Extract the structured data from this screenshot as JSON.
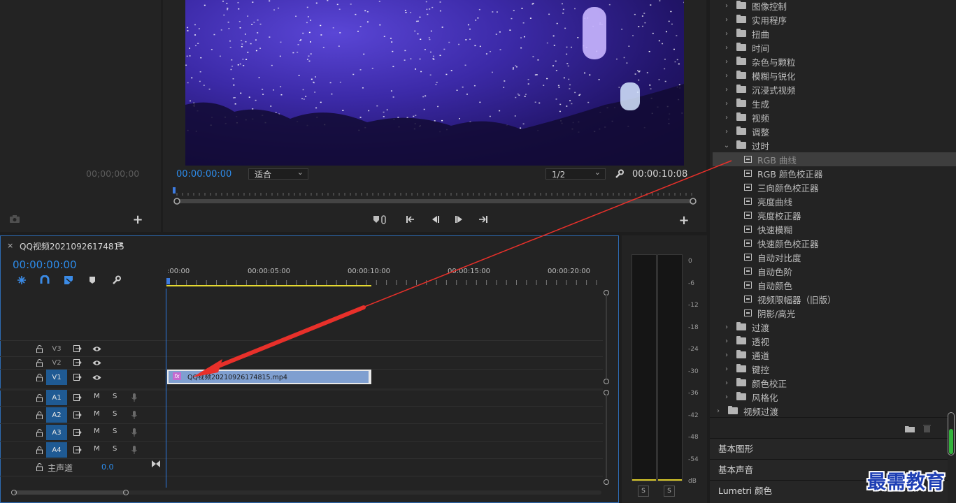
{
  "source": {
    "timecode": "00;00;00;00"
  },
  "program": {
    "timecode": "00:00:00:00",
    "fit": "适合",
    "resolution": "1/2",
    "duration": "00:00:10:08"
  },
  "timeline": {
    "sequence_name": "QQ视频20210926174815",
    "timecode": "00:00:00:00",
    "ruler": [
      ":00:00",
      "00:00:05:00",
      "00:00:10:00",
      "00:00:15:00",
      "00:00:20:00"
    ],
    "video_tracks": [
      "V3",
      "V2",
      "V1"
    ],
    "audio_tracks": [
      "A1",
      "A2",
      "A3",
      "A4"
    ],
    "target_video": "V1",
    "mute_label": "M",
    "solo_label": "S",
    "master_label": "主声道",
    "master_value": "0.0",
    "clip_label": "QQ视频20210926174815.mp4",
    "clip_fx": "fx"
  },
  "meter": {
    "scale": [
      "0",
      "-6",
      "-12",
      "-18",
      "-24",
      "-30",
      "-36",
      "-42",
      "-48",
      "-54",
      "dB"
    ],
    "solo_left": "S",
    "solo_right": "S"
  },
  "effects": {
    "folders_top": [
      "图像控制",
      "实用程序",
      "扭曲",
      "时间",
      "杂色与颗粒",
      "模糊与锐化",
      "沉浸式视频",
      "生成",
      "视频",
      "调整"
    ],
    "open_folder": "过时",
    "open_items": [
      "RGB 曲线",
      "RGB 颜色校正器",
      "三向颜色校正器",
      "亮度曲线",
      "亮度校正器",
      "快速模糊",
      "快速颜色校正器",
      "自动对比度",
      "自动色阶",
      "自动颜色",
      "视频限幅器（旧版）",
      "阴影/高光"
    ],
    "selected_item": "RGB 曲线",
    "folders_bottom": [
      "过渡",
      "透视",
      "通道",
      "键控",
      "颜色校正",
      "风格化"
    ],
    "root_folder": "视频过渡",
    "sections": [
      "基本图形",
      "基本声音",
      "Lumetri 颜色"
    ]
  },
  "watermark": "最需教育",
  "colors": {
    "accent": "#2d8ceb",
    "clip": "#7f9fd0",
    "arrow": "#e8302a",
    "track_target": "#1f5a93"
  }
}
